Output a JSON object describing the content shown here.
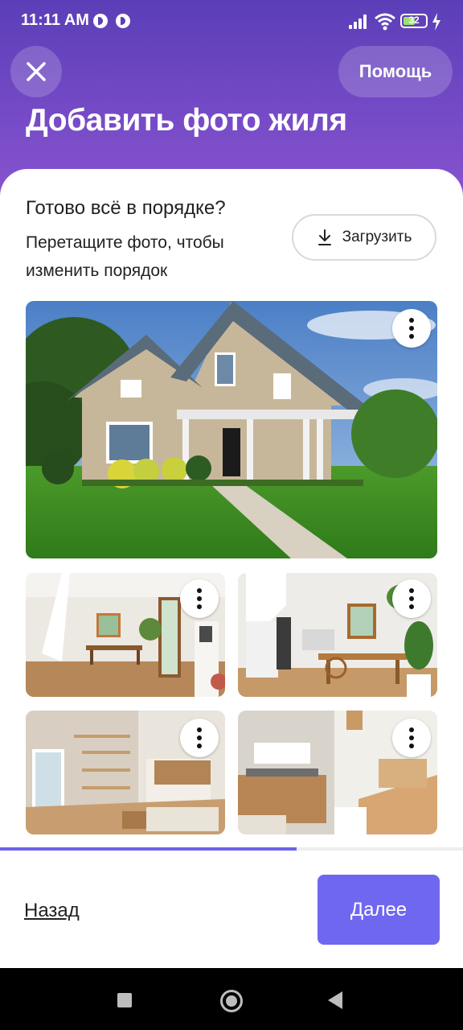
{
  "status_bar": {
    "time": "11:11 AM",
    "battery_level": "32",
    "icons": [
      "vpn-icon",
      "vpn-icon",
      "signal-icon",
      "wifi-icon",
      "battery-icon",
      "charging-icon"
    ]
  },
  "header": {
    "close_icon": "close-icon",
    "help_label": "Помощь",
    "title": "Добавить фото жиля"
  },
  "main": {
    "question": "Готово всё в порядке?",
    "hint": "Перетащите фото, чтобы изменить порядок",
    "upload_label": "Загрузить",
    "upload_icon": "download-icon",
    "photos": [
      {
        "kind": "house-exterior",
        "menu_icon": "more-vertical-icon"
      },
      {
        "kind": "interior-dining",
        "menu_icon": "more-vertical-icon"
      },
      {
        "kind": "interior-stairs-desk",
        "menu_icon": "more-vertical-icon"
      },
      {
        "kind": "interior-living-shelves",
        "menu_icon": "more-vertical-icon"
      },
      {
        "kind": "interior-kitchen",
        "menu_icon": "more-vertical-icon"
      }
    ]
  },
  "progress": {
    "fraction": 0.64,
    "color": "#6c63ea"
  },
  "footer": {
    "back_label": "Назад",
    "next_label": "Далее",
    "next_color": "#7067f0"
  },
  "colors": {
    "header_top": "#5a3fb8",
    "header_bottom": "#8a55d0"
  }
}
